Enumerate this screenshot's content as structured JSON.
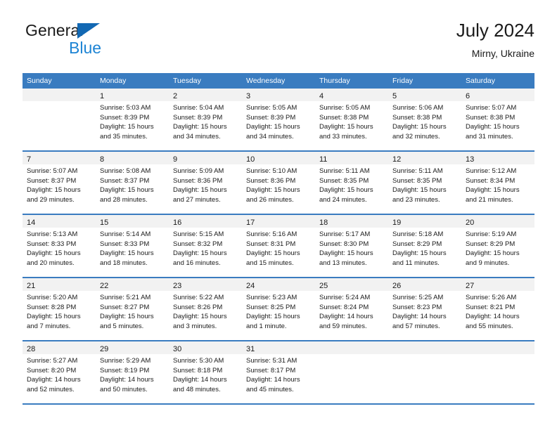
{
  "brand": {
    "word_one": "General",
    "word_two": "Blue",
    "triangle_icon": "brand-triangle-icon",
    "color_dark": "#1a1a1a",
    "color_blue": "#1d84d4",
    "color_triangle": "#1268b3"
  },
  "header": {
    "title": "July 2024",
    "subtitle": "Mirny, Ukraine"
  },
  "theme": {
    "header_band": "#3a7cc0",
    "daynum_band": "#f2f2f2",
    "grid_line": "#3a7cc0",
    "text": "#1a1a1a"
  },
  "weekdays": [
    "Sunday",
    "Monday",
    "Tuesday",
    "Wednesday",
    "Thursday",
    "Friday",
    "Saturday"
  ],
  "weeks": [
    [
      {
        "day": "",
        "lines": []
      },
      {
        "day": "1",
        "lines": [
          "Sunrise: 5:03 AM",
          "Sunset: 8:39 PM",
          "Daylight: 15 hours",
          "and 35 minutes."
        ]
      },
      {
        "day": "2",
        "lines": [
          "Sunrise: 5:04 AM",
          "Sunset: 8:39 PM",
          "Daylight: 15 hours",
          "and 34 minutes."
        ]
      },
      {
        "day": "3",
        "lines": [
          "Sunrise: 5:05 AM",
          "Sunset: 8:39 PM",
          "Daylight: 15 hours",
          "and 34 minutes."
        ]
      },
      {
        "day": "4",
        "lines": [
          "Sunrise: 5:05 AM",
          "Sunset: 8:38 PM",
          "Daylight: 15 hours",
          "and 33 minutes."
        ]
      },
      {
        "day": "5",
        "lines": [
          "Sunrise: 5:06 AM",
          "Sunset: 8:38 PM",
          "Daylight: 15 hours",
          "and 32 minutes."
        ]
      },
      {
        "day": "6",
        "lines": [
          "Sunrise: 5:07 AM",
          "Sunset: 8:38 PM",
          "Daylight: 15 hours",
          "and 31 minutes."
        ]
      }
    ],
    [
      {
        "day": "7",
        "lines": [
          "Sunrise: 5:07 AM",
          "Sunset: 8:37 PM",
          "Daylight: 15 hours",
          "and 29 minutes."
        ]
      },
      {
        "day": "8",
        "lines": [
          "Sunrise: 5:08 AM",
          "Sunset: 8:37 PM",
          "Daylight: 15 hours",
          "and 28 minutes."
        ]
      },
      {
        "day": "9",
        "lines": [
          "Sunrise: 5:09 AM",
          "Sunset: 8:36 PM",
          "Daylight: 15 hours",
          "and 27 minutes."
        ]
      },
      {
        "day": "10",
        "lines": [
          "Sunrise: 5:10 AM",
          "Sunset: 8:36 PM",
          "Daylight: 15 hours",
          "and 26 minutes."
        ]
      },
      {
        "day": "11",
        "lines": [
          "Sunrise: 5:11 AM",
          "Sunset: 8:35 PM",
          "Daylight: 15 hours",
          "and 24 minutes."
        ]
      },
      {
        "day": "12",
        "lines": [
          "Sunrise: 5:11 AM",
          "Sunset: 8:35 PM",
          "Daylight: 15 hours",
          "and 23 minutes."
        ]
      },
      {
        "day": "13",
        "lines": [
          "Sunrise: 5:12 AM",
          "Sunset: 8:34 PM",
          "Daylight: 15 hours",
          "and 21 minutes."
        ]
      }
    ],
    [
      {
        "day": "14",
        "lines": [
          "Sunrise: 5:13 AM",
          "Sunset: 8:33 PM",
          "Daylight: 15 hours",
          "and 20 minutes."
        ]
      },
      {
        "day": "15",
        "lines": [
          "Sunrise: 5:14 AM",
          "Sunset: 8:33 PM",
          "Daylight: 15 hours",
          "and 18 minutes."
        ]
      },
      {
        "day": "16",
        "lines": [
          "Sunrise: 5:15 AM",
          "Sunset: 8:32 PM",
          "Daylight: 15 hours",
          "and 16 minutes."
        ]
      },
      {
        "day": "17",
        "lines": [
          "Sunrise: 5:16 AM",
          "Sunset: 8:31 PM",
          "Daylight: 15 hours",
          "and 15 minutes."
        ]
      },
      {
        "day": "18",
        "lines": [
          "Sunrise: 5:17 AM",
          "Sunset: 8:30 PM",
          "Daylight: 15 hours",
          "and 13 minutes."
        ]
      },
      {
        "day": "19",
        "lines": [
          "Sunrise: 5:18 AM",
          "Sunset: 8:29 PM",
          "Daylight: 15 hours",
          "and 11 minutes."
        ]
      },
      {
        "day": "20",
        "lines": [
          "Sunrise: 5:19 AM",
          "Sunset: 8:29 PM",
          "Daylight: 15 hours",
          "and 9 minutes."
        ]
      }
    ],
    [
      {
        "day": "21",
        "lines": [
          "Sunrise: 5:20 AM",
          "Sunset: 8:28 PM",
          "Daylight: 15 hours",
          "and 7 minutes."
        ]
      },
      {
        "day": "22",
        "lines": [
          "Sunrise: 5:21 AM",
          "Sunset: 8:27 PM",
          "Daylight: 15 hours",
          "and 5 minutes."
        ]
      },
      {
        "day": "23",
        "lines": [
          "Sunrise: 5:22 AM",
          "Sunset: 8:26 PM",
          "Daylight: 15 hours",
          "and 3 minutes."
        ]
      },
      {
        "day": "24",
        "lines": [
          "Sunrise: 5:23 AM",
          "Sunset: 8:25 PM",
          "Daylight: 15 hours",
          "and 1 minute."
        ]
      },
      {
        "day": "25",
        "lines": [
          "Sunrise: 5:24 AM",
          "Sunset: 8:24 PM",
          "Daylight: 14 hours",
          "and 59 minutes."
        ]
      },
      {
        "day": "26",
        "lines": [
          "Sunrise: 5:25 AM",
          "Sunset: 8:23 PM",
          "Daylight: 14 hours",
          "and 57 minutes."
        ]
      },
      {
        "day": "27",
        "lines": [
          "Sunrise: 5:26 AM",
          "Sunset: 8:21 PM",
          "Daylight: 14 hours",
          "and 55 minutes."
        ]
      }
    ],
    [
      {
        "day": "28",
        "lines": [
          "Sunrise: 5:27 AM",
          "Sunset: 8:20 PM",
          "Daylight: 14 hours",
          "and 52 minutes."
        ]
      },
      {
        "day": "29",
        "lines": [
          "Sunrise: 5:29 AM",
          "Sunset: 8:19 PM",
          "Daylight: 14 hours",
          "and 50 minutes."
        ]
      },
      {
        "day": "30",
        "lines": [
          "Sunrise: 5:30 AM",
          "Sunset: 8:18 PM",
          "Daylight: 14 hours",
          "and 48 minutes."
        ]
      },
      {
        "day": "31",
        "lines": [
          "Sunrise: 5:31 AM",
          "Sunset: 8:17 PM",
          "Daylight: 14 hours",
          "and 45 minutes."
        ]
      },
      {
        "day": "",
        "lines": []
      },
      {
        "day": "",
        "lines": []
      },
      {
        "day": "",
        "lines": []
      }
    ]
  ]
}
